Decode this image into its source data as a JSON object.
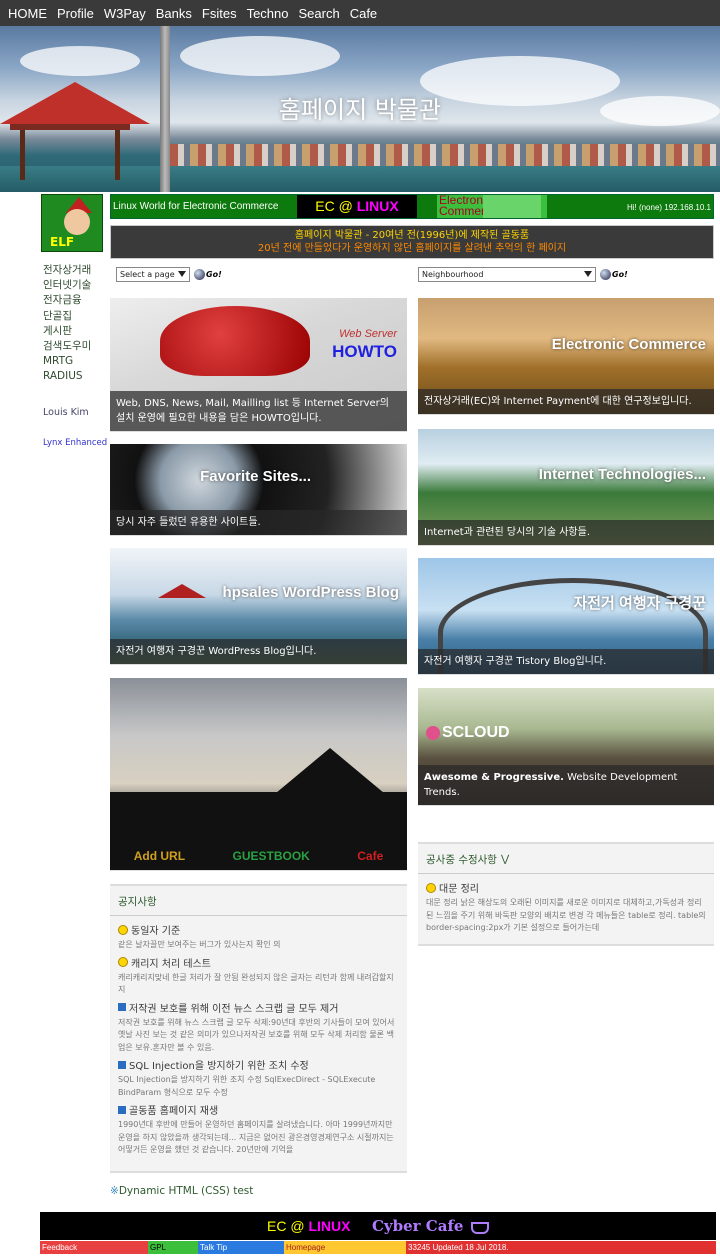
{
  "nav": [
    "HOME",
    "Profile",
    "W3Pay",
    "Banks",
    "Fsites",
    "Techno",
    "Search",
    "Cafe"
  ],
  "hero": {
    "title": "홈페이지 박물관"
  },
  "logo": {
    "text": "ELF"
  },
  "banner": {
    "left": "Linux World for Electronic Commerce",
    "ec": "EC",
    "at": "@",
    "linux": "LINUX",
    "ec2_line1": "Electronic",
    "ec2_line2": "Commerce",
    "right": "Hi! (none) 192.168.10.1"
  },
  "notice": {
    "line1": "홈페이지 박물관 - 20여년 전(1996년)에 제작된 골동품",
    "line2": "20년 전에 만들었다가 운영하지 않던 홈페이지를 살려낸 추억의 한 페이지"
  },
  "sidebar": {
    "items": [
      "전자상거래",
      "인터넷기술",
      "전자금융",
      "단골집",
      "게시판",
      "검색도우미",
      "MRTG",
      "RADIUS"
    ],
    "author": "Louis Kim",
    "lynx": "Lynx Enhanced"
  },
  "selects": {
    "left": "Select a page",
    "right": "Neighbourhood",
    "go": "Go!"
  },
  "cards": {
    "howto": {
      "tag1": "Web Server",
      "tag2": "HOWTO",
      "caption": "Web, DNS, News, Mail, Mailling list 등 Internet Server의 설치 운영에 필요한 내용을 담은 HOWTO입니다."
    },
    "ec": {
      "title": "Electronic Commerce",
      "caption": "전자상거래(EC)와 Internet Payment에 대한 연구정보입니다."
    },
    "fav": {
      "title": "Favorite Sites...",
      "caption": "당시 자주 들렀던 유용한 사이트들."
    },
    "tech": {
      "title": "Internet Technologies...",
      "caption": "Internet과 관련된 당시의 기술 사항들."
    },
    "wp": {
      "title": "hpsales WordPress Blog",
      "caption": "자전거 여행자 구경꾼 WordPress Blog입니다."
    },
    "tistory": {
      "title": "자전거 여행자 구경꾼",
      "caption": "자전거 여행자 구경꾼 Tistory Blog입니다."
    },
    "guest": {
      "add": "Add URL",
      "gb": "GUESTBOOK",
      "cafe": "Cafe"
    },
    "scloud": {
      "title": "SCLOUD",
      "caption_bold": "Awesome & Progressive.",
      "caption": " Website Development Trends."
    }
  },
  "notices": {
    "heading": "공지사항",
    "items": [
      {
        "title": "동일자 기준",
        "desc": "같은 날자끌만 보여주는 버그가 있사는지 확인 의",
        "icon": "smile"
      },
      {
        "title": "캐리지 처리 테스트",
        "desc": "캐리캐리지맞네 한글 처리가 잘 안됨 완성되지 않은 글자는 리턴과 함께 내려갑할지 지",
        "icon": "smile"
      },
      {
        "title": "저작권 보호를 위해 이전 뉴스 스크랩 글 모두 제거",
        "desc": "저작권 보호를 위해 뉴스 스크랩 글 모두 삭제:90년대 후반의 기사들이 모여 있어서 옛날 사진 보는 것 같은 의미가 있으나저작권 보호를 위해 모두 삭제 처리함 물론 백업은 보유.혼자만 볼 수 있음.",
        "icon": "sq"
      },
      {
        "title": "SQL Injection을 방지하기 위한 조치 수정",
        "desc": "SQL Injection을 방지하기 위한 조치 수정 SqlExecDirect - SQLExecute BindParam 형식으로 모두 수정",
        "icon": "sq"
      },
      {
        "title": "골동품 홈페이지 재생",
        "desc": "1990년대 후반에 만들어 운영하던 홈페이지를 살려냈습니다. 아마 1999년까지만 운영을 하지 않았을까 생각되는데... 지금은 없어진 광은경영경제연구소 시절까지는 어떻거든 운영을 했던 것 같습니다. 20년만에 기억을",
        "icon": "sq"
      }
    ]
  },
  "updates": {
    "heading": "공사중 수정사항",
    "title": "대문 정리",
    "desc": "대문 정리 낡은 해상도의 오래된 이미지를 새로운 이미지로 대체하고,가독성과 정리된 느낌을 주기 위해 바둑판 모양의 배치로 변경 각 메뉴들은 table로 정리. table의 border-spacing:2px가 기본 설정으로 들어가는데"
  },
  "dhtml": "Dynamic HTML (CSS) test",
  "footer": {
    "ec": "EC",
    "at": "@",
    "linux": "LINUX",
    "cafe": "Cyber Cafe",
    "links": [
      "Feedback",
      "GPL",
      "Talk Tip",
      "Homepage",
      "33245 Updated 18 Jul 2018."
    ]
  },
  "colors": {
    "nav_bg": "#3a3a3a",
    "accent_green": "#2e5a2e",
    "notice_yellow": "#ffd400",
    "notice_orange": "#ff8a00"
  }
}
